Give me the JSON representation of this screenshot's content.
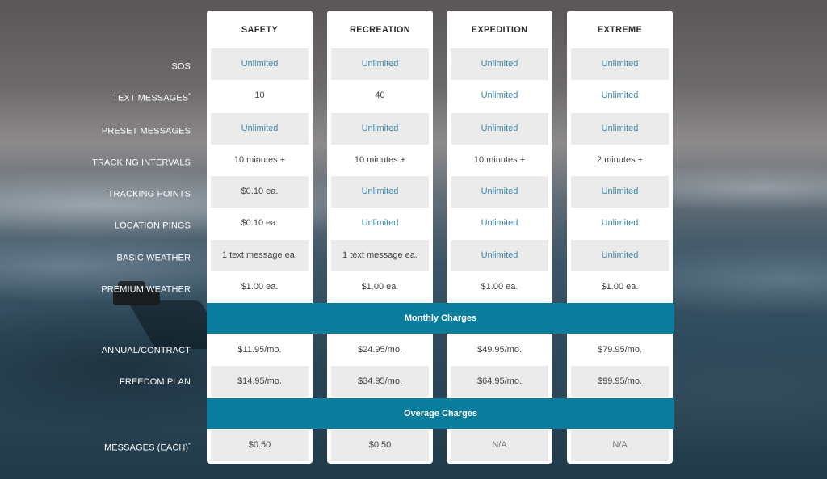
{
  "columns": [
    {
      "name": "SAFETY",
      "values": [
        "Unlimited",
        "10",
        "Unlimited",
        "10 minutes +",
        "$0.10 ea.",
        "$0.10 ea.",
        "1 text message ea.",
        "$1.00 ea."
      ],
      "monthly": [
        "$11.95/mo.",
        "$14.95/mo."
      ],
      "overage": [
        "$0.50"
      ]
    },
    {
      "name": "RECREATION",
      "values": [
        "Unlimited",
        "40",
        "Unlimited",
        "10 minutes +",
        "Unlimited",
        "Unlimited",
        "1 text message ea.",
        "$1.00 ea."
      ],
      "monthly": [
        "$24.95/mo.",
        "$34.95/mo."
      ],
      "overage": [
        "$0.50"
      ]
    },
    {
      "name": "EXPEDITION",
      "values": [
        "Unlimited",
        "Unlimited",
        "Unlimited",
        "10 minutes +",
        "Unlimited",
        "Unlimited",
        "Unlimited",
        "$1.00 ea."
      ],
      "monthly": [
        "$49.95/mo.",
        "$64.95/mo."
      ],
      "overage": [
        "N/A"
      ]
    },
    {
      "name": "EXTREME",
      "values": [
        "Unlimited",
        "Unlimited",
        "Unlimited",
        "2 minutes +",
        "Unlimited",
        "Unlimited",
        "Unlimited",
        "$1.00 ea."
      ],
      "monthly": [
        "$79.95/mo.",
        "$99.95/mo."
      ],
      "overage": [
        "N/A"
      ]
    }
  ],
  "features": [
    "SOS",
    "TEXT MESSAGES",
    "PRESET MESSAGES",
    "TRACKING INTERVALS",
    "TRACKING POINTS",
    "LOCATION PINGS",
    "BASIC WEATHER",
    "PREMIUM WEATHER"
  ],
  "feature_marks": [
    "",
    "*",
    "",
    "",
    "",
    "",
    "",
    ""
  ],
  "monthly_band": "Monthly Charges",
  "monthly_rows": [
    "ANNUAL/CONTRACT",
    "FREEDOM PLAN"
  ],
  "overage_band": "Overage Charges",
  "overage_rows": [
    "MESSAGES (EACH)"
  ],
  "overage_marks": [
    "*"
  ],
  "colors": {
    "band": "#0a7c9c",
    "unlimited": "#3d87a8",
    "cell_gray": "#ebebeb"
  }
}
